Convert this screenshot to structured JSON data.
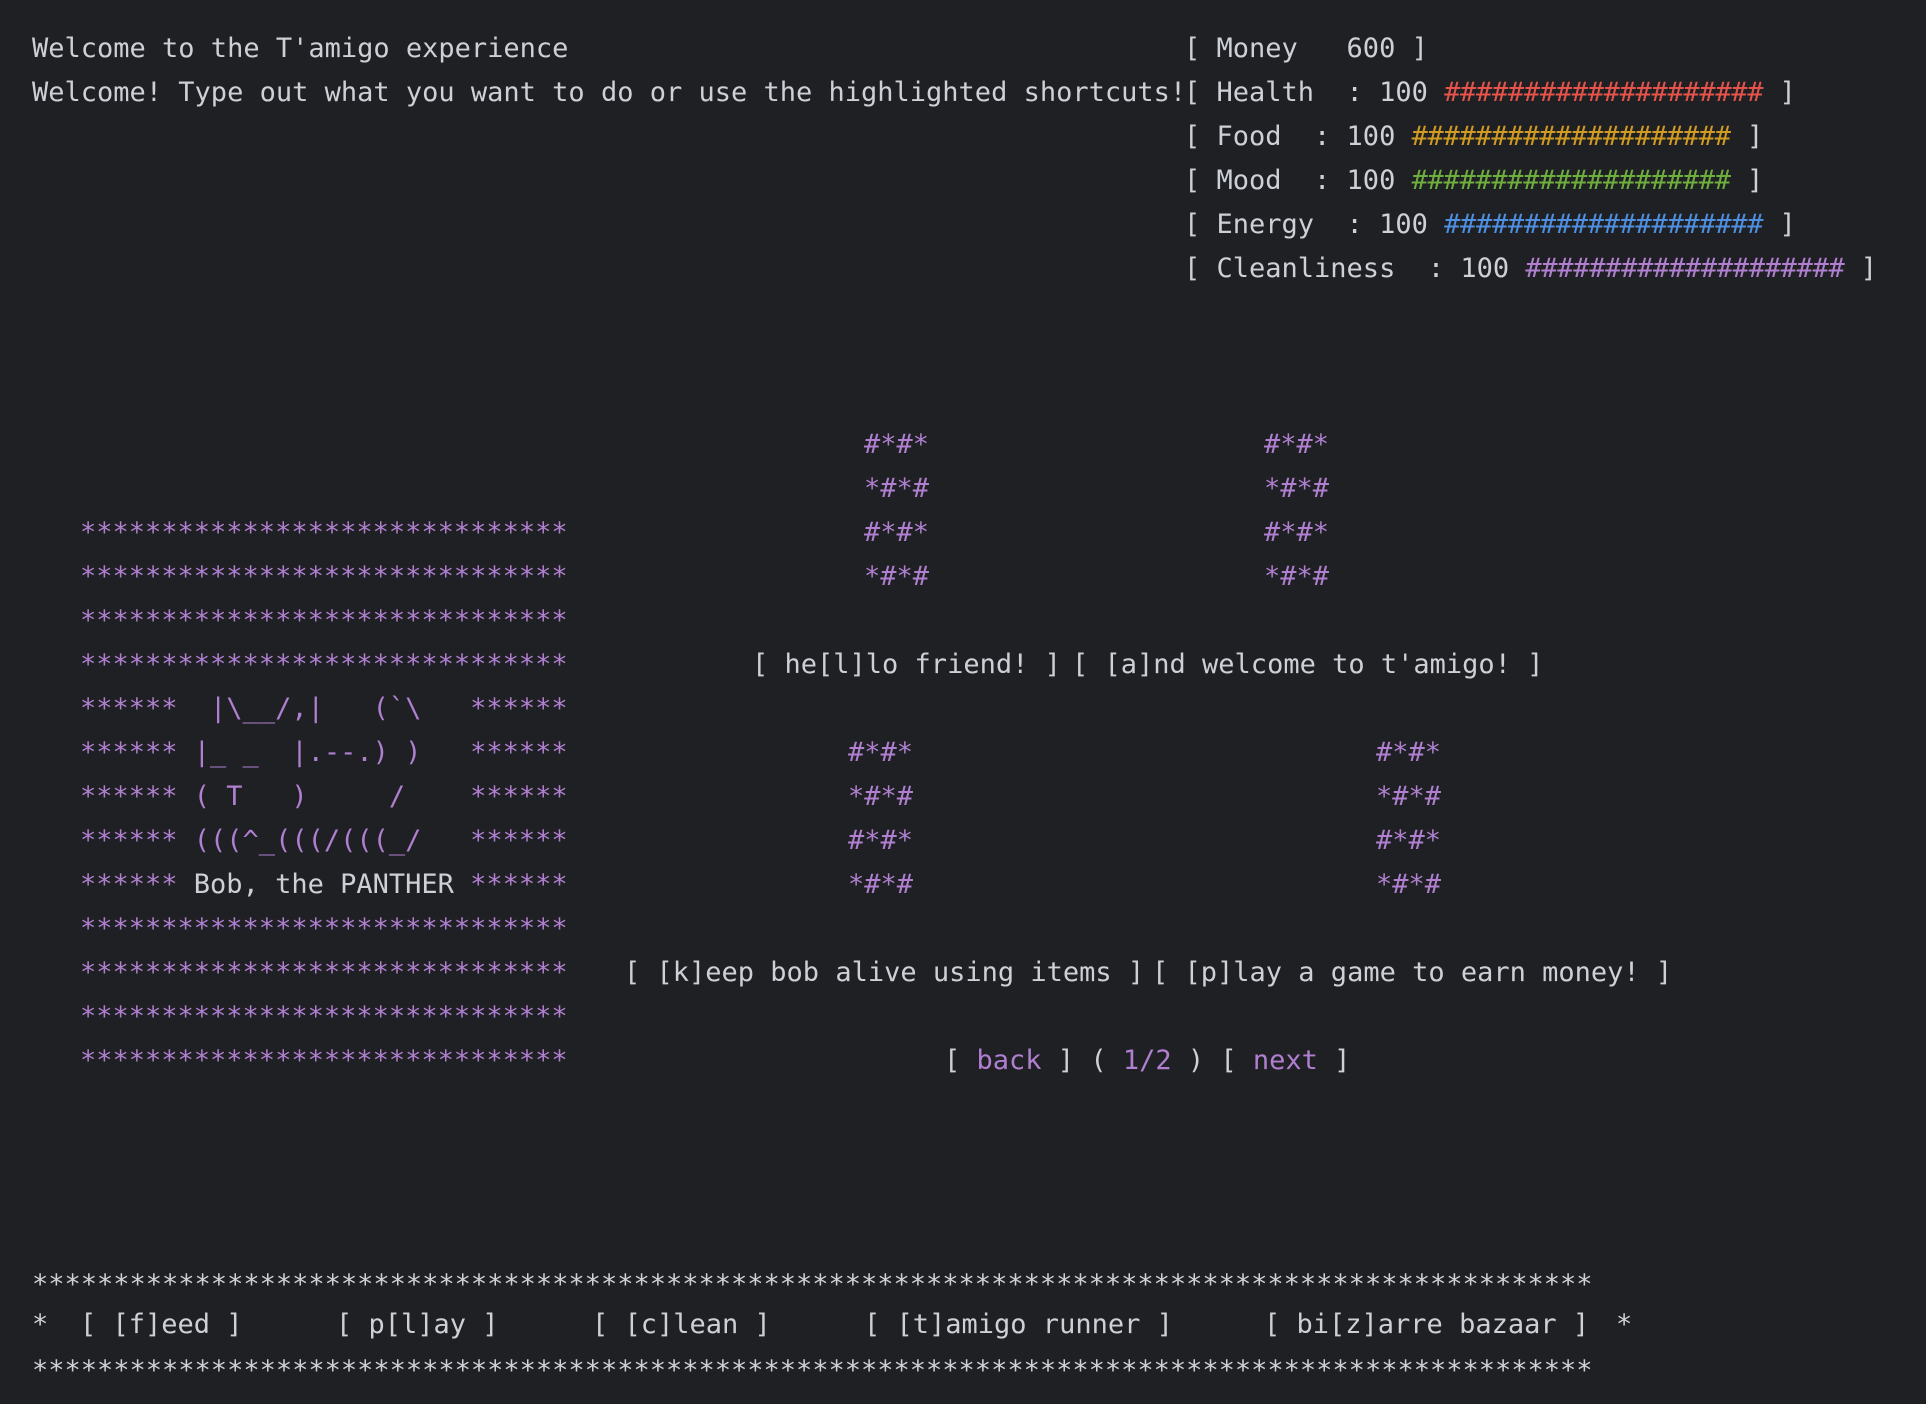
{
  "header": {
    "title": "Welcome to the T'amigo experience",
    "subtitle": "Welcome! Type out what you want to do or use the highlighted shortcuts!"
  },
  "stats": {
    "money": {
      "label": "[ Money   600 ]"
    },
    "items": [
      {
        "prefix": "[ Health  : 100 ",
        "bar": "####################",
        "suffix": " ]",
        "value": 100,
        "color": "#e5534b"
      },
      {
        "prefix": "[ Food  : 100 ",
        "bar": "####################",
        "suffix": " ]",
        "value": 100,
        "color": "#d19a22"
      },
      {
        "prefix": "[ Mood  : 100 ",
        "bar": "####################",
        "suffix": " ]",
        "value": 100,
        "color": "#6dae3f"
      },
      {
        "prefix": "[ Energy  : 100 ",
        "bar": "####################",
        "suffix": " ]",
        "value": 100,
        "color": "#4e8fe0"
      },
      {
        "prefix": "[ Cleanliness  : 100 ",
        "bar": "####################",
        "suffix": " ]",
        "value": 100,
        "color": "#b07fd0"
      }
    ]
  },
  "pet": {
    "frame_row": "******************************",
    "art_1": "******  |\\__/,|   (`\\   ******",
    "art_2": "****** |_ _  |.--.) )   ******",
    "art_3": "****** ( T   )     /    ******",
    "art_4": "****** (((^_(((/(((_/   ******",
    "name_prefix": "****** ",
    "name": "Bob, the PANTHER",
    "name_suffix": " ******"
  },
  "deco": {
    "a": "#*#*",
    "b": "*#*#"
  },
  "menu": {
    "hello_btn": "[ he[l]lo friend! ]",
    "welcome_btn": "[ [a]nd welcome to t'amigo! ]",
    "keep_btn": "[ [k]eep bob alive using items ]",
    "play_game_btn": "[ [p]lay a game to earn money! ]"
  },
  "pager": {
    "open1": "[ ",
    "back": "back",
    "close1": " ] ( ",
    "page": "1/2",
    "close2": " ) [ ",
    "next": "next",
    "close3": " ]"
  },
  "footer": {
    "border": "************************************************************************************************",
    "star": "*",
    "feed": "[ [f]eed ]",
    "play": "[ p[l]ay ]",
    "clean": "[ [c]lean ]",
    "runner": "[ [t]amigo runner ]",
    "bazaar": "[ bi[z]arre bazaar ]"
  }
}
